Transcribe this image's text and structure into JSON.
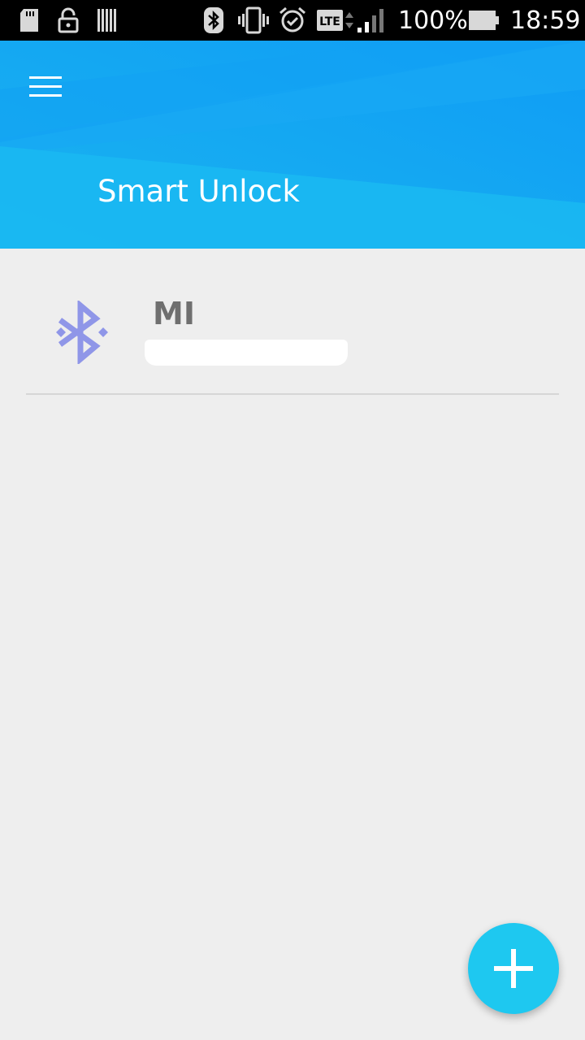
{
  "status_bar": {
    "battery_percent": "100%",
    "time": "18:59",
    "network_type": "LTE",
    "icons": [
      "sd-card-icon",
      "lock-icon",
      "barcode-icon",
      "bluetooth-icon",
      "vibrate-icon",
      "alarm-icon",
      "lte-icon",
      "signal-icon",
      "battery-icon"
    ]
  },
  "header": {
    "title": "Smart Unlock",
    "menu_icon": "hamburger-menu-icon",
    "gradient_colors": [
      "#1ab4ef",
      "#0f9cf5"
    ]
  },
  "devices": [
    {
      "name": "MI",
      "address": "",
      "icon": "bluetooth-icon",
      "icon_color": "#8f96e8"
    }
  ],
  "fab": {
    "icon": "plus-icon",
    "color": "#1ec8f0"
  }
}
